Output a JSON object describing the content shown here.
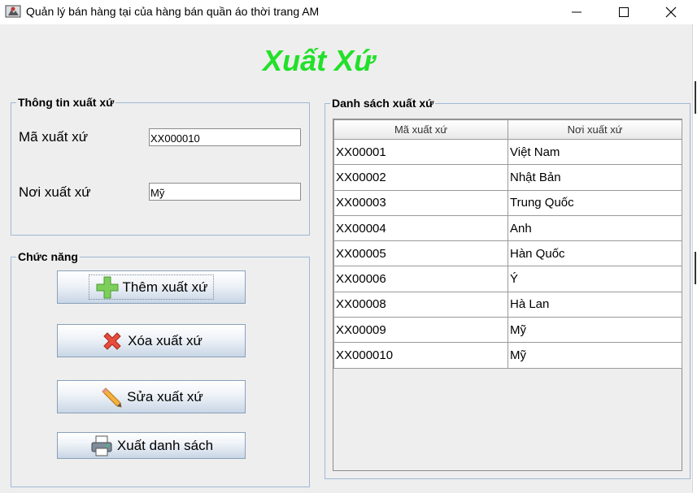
{
  "window": {
    "title": "Quản lý bán hàng tại của hàng bán quần áo thời trang AM",
    "icon": "app-icon"
  },
  "heading": "Xuất Xứ",
  "info_group": {
    "title": "Thông tin xuất xứ",
    "code_label": "Mã xuất xứ",
    "code_value": "XX000010",
    "origin_label": "Nơi xuất xứ",
    "origin_value": "Mỹ"
  },
  "function_group": {
    "title": "Chức năng",
    "buttons": [
      {
        "label": "Thêm xuất xứ",
        "icon": "plus-icon"
      },
      {
        "label": "Xóa xuất xứ",
        "icon": "delete-x-icon"
      },
      {
        "label": "Sửa xuất xứ",
        "icon": "pencil-icon"
      },
      {
        "label": "Xuất danh sách",
        "icon": "printer-icon"
      }
    ]
  },
  "list_group": {
    "title": "Danh sách xuất xứ",
    "columns": [
      "Mã xuất xứ",
      "Nơi xuất xứ"
    ],
    "rows": [
      [
        "XX00001",
        "Việt Nam"
      ],
      [
        "XX00002",
        "Nhật Bản"
      ],
      [
        "XX00003",
        "Trung Quốc"
      ],
      [
        "XX00004",
        "Anh"
      ],
      [
        "XX00005",
        "Hàn Quốc"
      ],
      [
        "XX00006",
        "Ý"
      ],
      [
        "XX00008",
        "Hà Lan"
      ],
      [
        "XX00009",
        "Mỹ"
      ],
      [
        "XX000010",
        "Mỹ"
      ]
    ]
  },
  "colors": {
    "heading": "#22e02a",
    "border": "#9fb8d4",
    "background": "#eeeeee"
  }
}
